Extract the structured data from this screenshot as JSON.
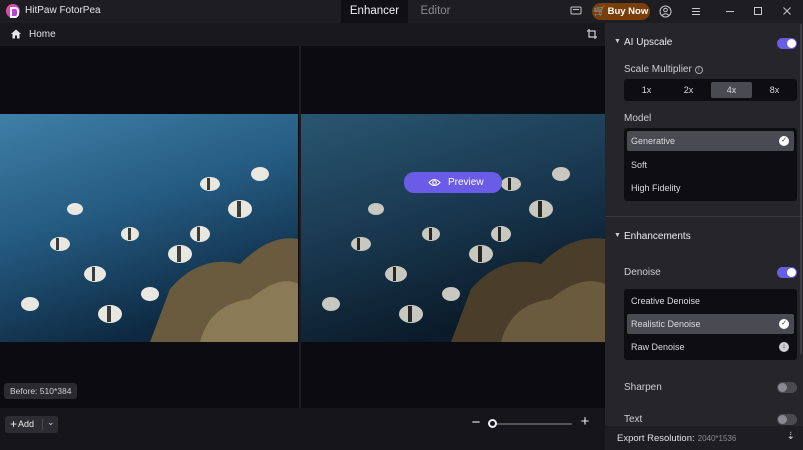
{
  "app": {
    "title": "HitPaw FotorPea"
  },
  "tabs": [
    {
      "label": "Enhancer",
      "active": true
    },
    {
      "label": "Editor",
      "active": false
    }
  ],
  "titlebar": {
    "buy_label": "Buy Now"
  },
  "subbar": {
    "home_label": "Home"
  },
  "canvas": {
    "preview_label": "Preview",
    "before_badge": "Before: 510*384"
  },
  "bottombar": {
    "add_label": "Add"
  },
  "panel": {
    "ai_upscale": {
      "title": "AI Upscale",
      "enabled": true,
      "scale_label": "Scale Multiplier",
      "scales": [
        "1x",
        "2x",
        "4x",
        "8x"
      ],
      "selected_scale": "4x",
      "model_label": "Model",
      "models": [
        "Generative",
        "Soft",
        "High Fidelity"
      ],
      "selected_model": "Generative"
    },
    "enhancements": {
      "title": "Enhancements",
      "denoise_label": "Denoise",
      "denoise_enabled": true,
      "denoise_options": [
        "Creative Denoise",
        "Realistic Denoise",
        "Raw Denoise"
      ],
      "selected_denoise": "Realistic Denoise",
      "sharpen_label": "Sharpen",
      "sharpen_enabled": false,
      "text_label": "Text",
      "text_enabled": false
    },
    "export": {
      "label": "Export Resolution:",
      "value": "2040*1536"
    }
  },
  "colors": {
    "accent": "#6b5ce8",
    "buy_button": "#7a3e0a",
    "panel_bg": "#25252a"
  }
}
